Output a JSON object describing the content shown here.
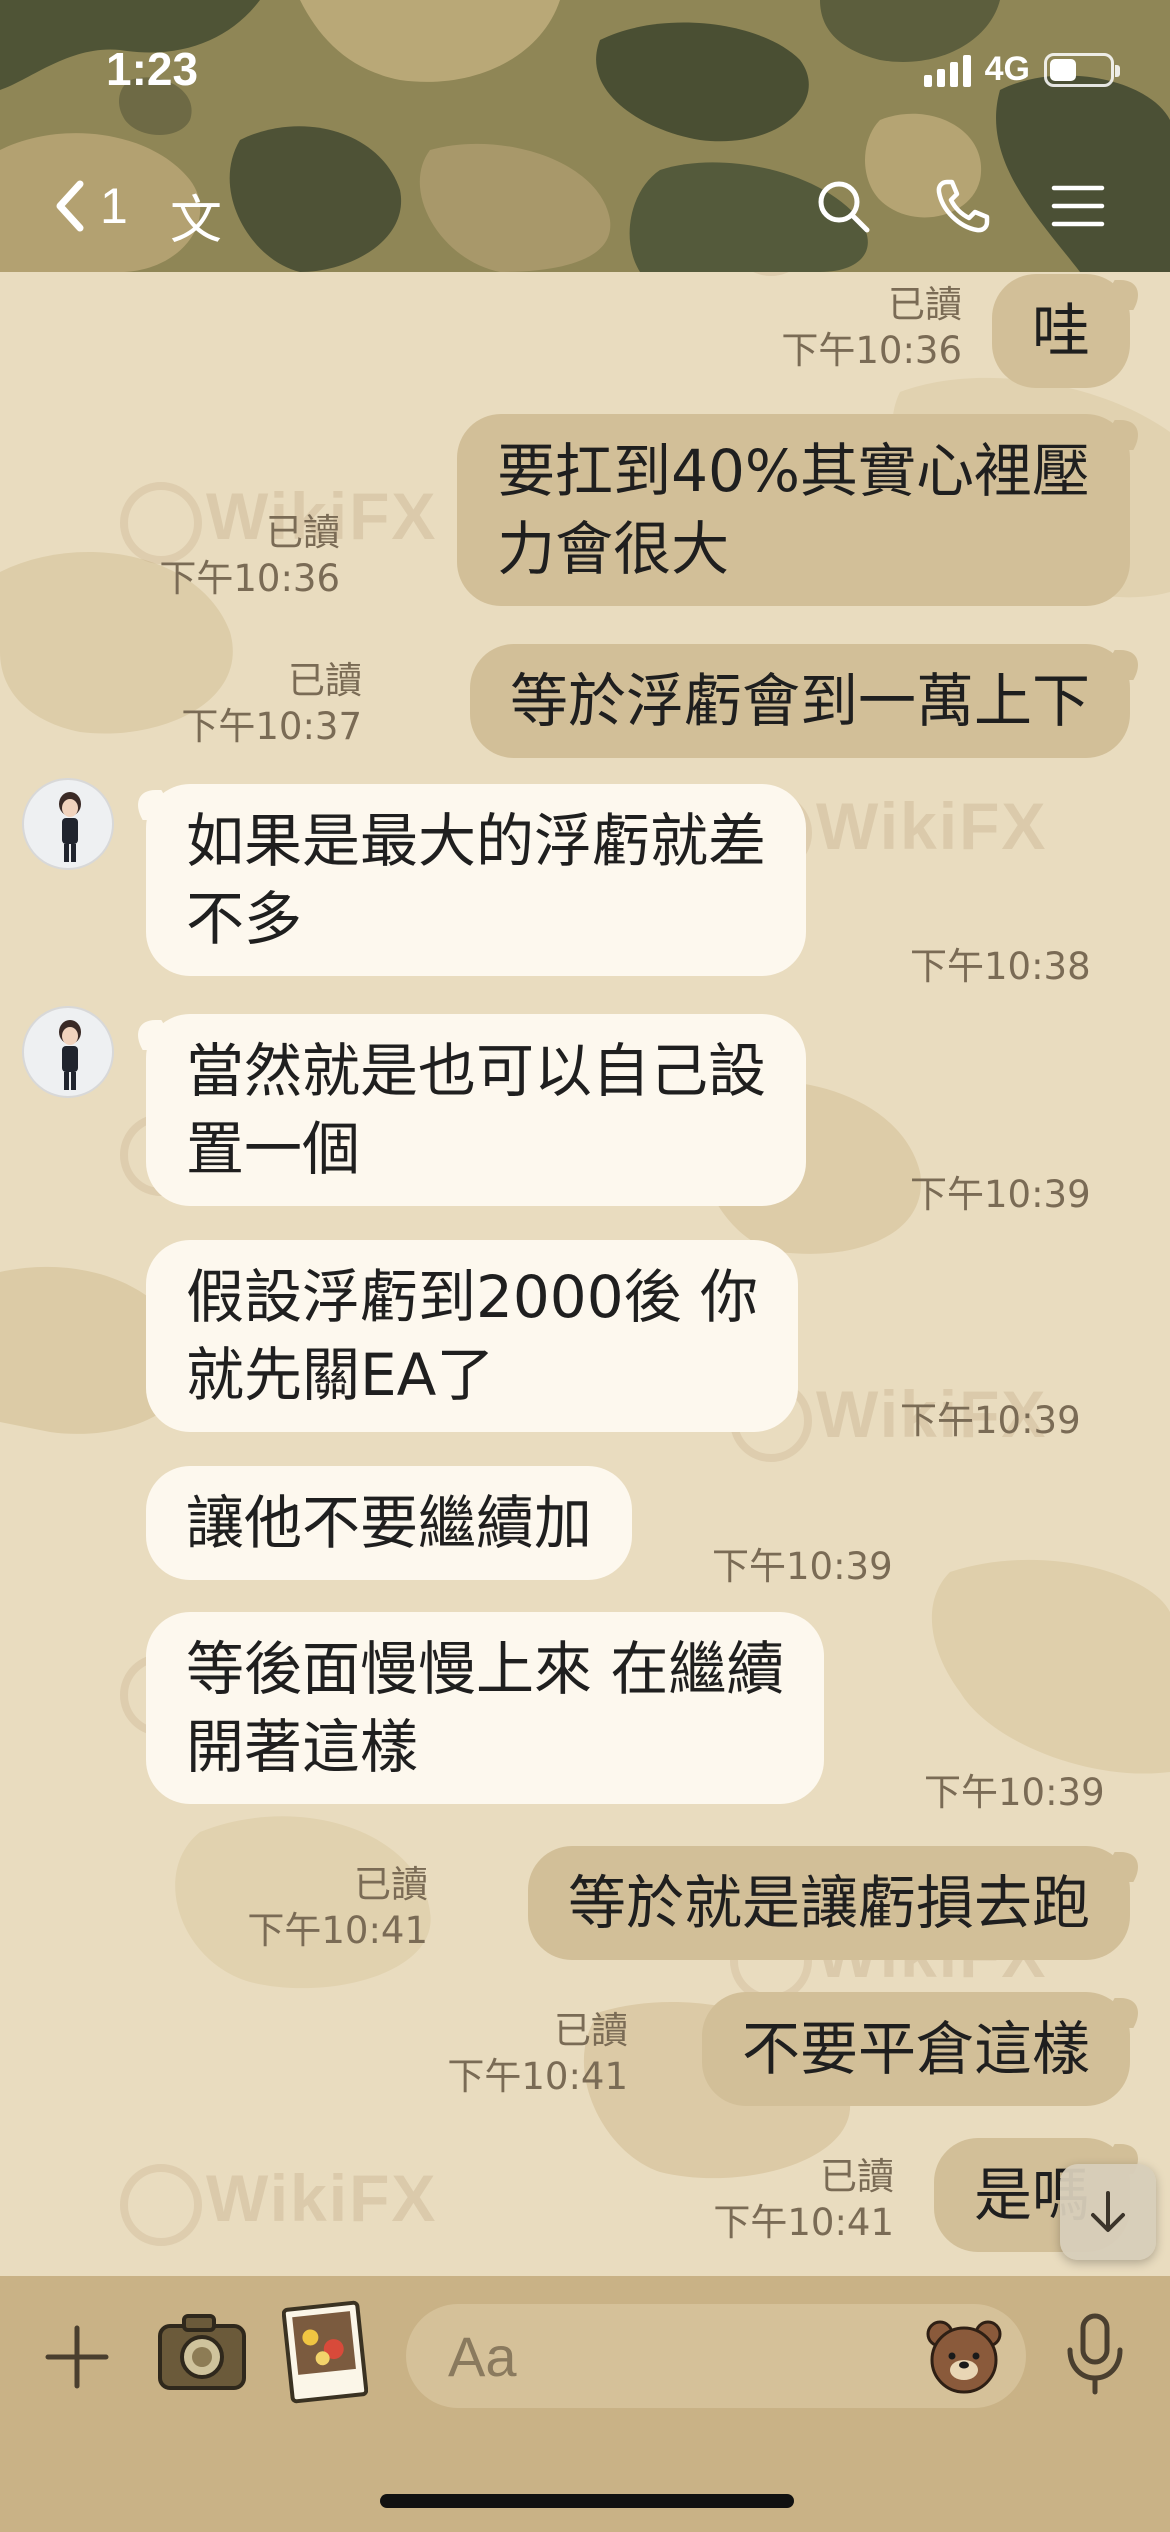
{
  "status_bar": {
    "time": "1:23",
    "network": "4G",
    "battery_level": 0.45
  },
  "header": {
    "unread_count": "1",
    "chat_name": "文",
    "icons": [
      "back-chevron-icon",
      "search-icon",
      "phone-icon",
      "menu-icon"
    ]
  },
  "watermark_text": "WikiFX",
  "messages": [
    {
      "side": "out",
      "text": [
        "哇"
      ],
      "read": "已讀",
      "time": "下午10:36"
    },
    {
      "side": "out",
      "text": [
        "要扛到40%其實心裡壓",
        "力會很大"
      ],
      "read": "已讀",
      "time": "下午10:36"
    },
    {
      "side": "out",
      "text": [
        "等於浮虧會到一萬上下"
      ],
      "read": "已讀",
      "time": "下午10:37"
    },
    {
      "side": "in",
      "text": [
        "如果是最大的浮虧就差",
        "不多"
      ],
      "time": "下午10:38"
    },
    {
      "side": "in",
      "text": [
        "當然就是也可以自己設",
        "置一個"
      ],
      "time": "下午10:39"
    },
    {
      "side": "in",
      "text": [
        "假設浮虧到2000後 你",
        "就先關EA了"
      ],
      "time": "下午10:39"
    },
    {
      "side": "in",
      "text": [
        "讓他不要繼續加"
      ],
      "time": "下午10:39"
    },
    {
      "side": "in",
      "text": [
        "等後面慢慢上來 在繼續",
        "開著這樣"
      ],
      "time": "下午10:39"
    },
    {
      "side": "out",
      "text": [
        "等於就是讓虧損去跑"
      ],
      "read": "已讀",
      "time": "下午10:41"
    },
    {
      "side": "out",
      "text": [
        "不要平倉這樣"
      ],
      "read": "已讀",
      "time": "下午10:41"
    },
    {
      "side": "out",
      "text": [
        "是嗎"
      ],
      "read": "已讀",
      "time": "下午10:41"
    }
  ],
  "input_bar": {
    "placeholder": "Aa",
    "icons": [
      "plus-icon",
      "camera-icon",
      "photo-icon",
      "sticker-icon",
      "microphone-icon"
    ]
  },
  "colors": {
    "outgoing_bubble": "#d2bf98",
    "incoming_bubble": "#fdf8ee",
    "chat_background": "#e9dcbf",
    "input_bar": "#c9b286"
  }
}
